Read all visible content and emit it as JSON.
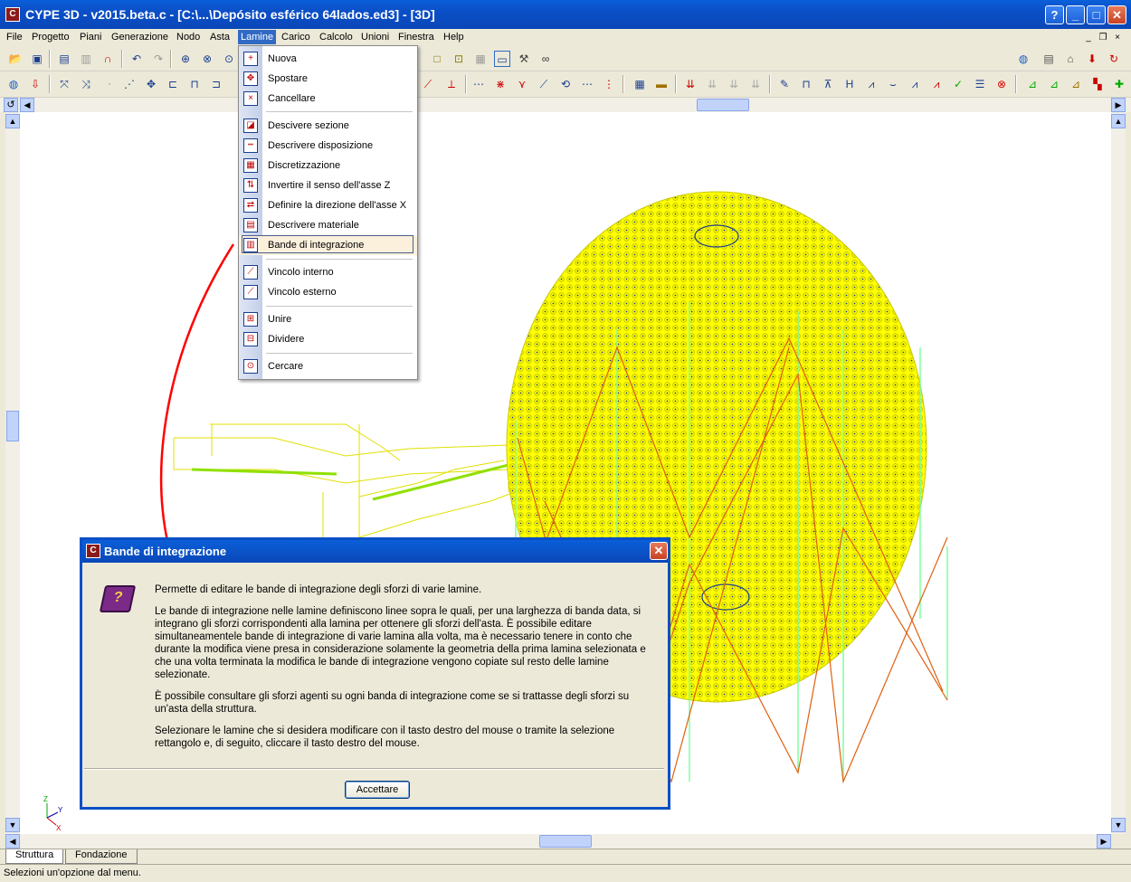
{
  "window": {
    "title": "CYPE 3D - v2015.beta.c - [C:\\...\\Depósito esférico 64lados.ed3] - [3D]",
    "app_icon_letter": "C",
    "help_btn": "?",
    "minimize_btn": "_",
    "maximize_btn": "□",
    "close_btn": "✕"
  },
  "menubar": {
    "items": [
      {
        "label": "File"
      },
      {
        "label": "Progetto"
      },
      {
        "label": "Piani"
      },
      {
        "label": "Generazione"
      },
      {
        "label": "Nodo"
      },
      {
        "label": "Asta"
      },
      {
        "label": "Lamine"
      },
      {
        "label": "Carico"
      },
      {
        "label": "Calcolo"
      },
      {
        "label": "Unioni"
      },
      {
        "label": "Finestra"
      },
      {
        "label": "Help"
      }
    ],
    "mdi_minimize": "_",
    "mdi_restore": "❐",
    "mdi_close": "×"
  },
  "dropdown": {
    "items": [
      {
        "label": "Nuova",
        "icon": "+"
      },
      {
        "label": "Spostare",
        "icon": "✥"
      },
      {
        "label": "Cancellare",
        "icon": "×"
      },
      {
        "label": "Descivere sezione",
        "icon": "◪"
      },
      {
        "label": "Descrivere disposizione",
        "icon": "┅"
      },
      {
        "label": "Discretizzazione",
        "icon": "▦"
      },
      {
        "label": "Invertire il senso dell'asse Z",
        "icon": "⇅"
      },
      {
        "label": "Definire la direzione dell'asse X",
        "icon": "⇄"
      },
      {
        "label": "Descrivere materiale",
        "icon": "▤"
      },
      {
        "label": "Bande di integrazione",
        "icon": "▥"
      },
      {
        "label": "Vincolo interno",
        "icon": "⟋"
      },
      {
        "label": "Vincolo esterno",
        "icon": "⟋"
      },
      {
        "label": "Unire",
        "icon": "⊞"
      },
      {
        "label": "Dividere",
        "icon": "⊟"
      },
      {
        "label": "Cercare",
        "icon": "⊙"
      }
    ]
  },
  "dialog": {
    "title": "Bande di integrazione",
    "close": "✕",
    "book_icon": "?",
    "paragraphs": [
      "Permette di editare le bande di integrazione degli sforzi di varie lamine.",
      "Le bande di integrazione nelle lamine definiscono linee sopra le quali, per una larghezza di banda data, si integrano gli sforzi corrispondenti alla lamina per ottenere gli sforzi dell'asta. È possibile editare simultaneamentele bande di integrazione di varie lamina alla volta, ma è necessario tenere in conto che durante la modifica viene presa in considerazione solamente la geometria della prima lamina selezionata e che una volta terminata la modifica le bande di integrazione vengono copiate sul resto delle lamine selezionate.",
      "È possibile consultare gli sforzi agenti su ogni banda di integrazione come se si trattasse degli sforzi su un'asta della struttura.",
      "Selezionare le lamine che si desidera modificare con il tasto destro del mouse o tramite la selezione rettangolo e, di seguito, cliccare il tasto destro del mouse."
    ],
    "ok_label": "Accettare"
  },
  "tabs": [
    {
      "label": "Struttura"
    },
    {
      "label": "Fondazione"
    }
  ],
  "status": "Selezioni un'opzione dal menu.",
  "axis": {
    "x": "X",
    "y": "Y",
    "z": "Z"
  },
  "colors": {
    "sphere_fill": "#ffff00",
    "sphere_mesh": "#c8c800",
    "bracing": "#e06010",
    "columns": "#80ffa0",
    "arrow": "#ff0000",
    "xp_blue": "#0b4fc7"
  }
}
